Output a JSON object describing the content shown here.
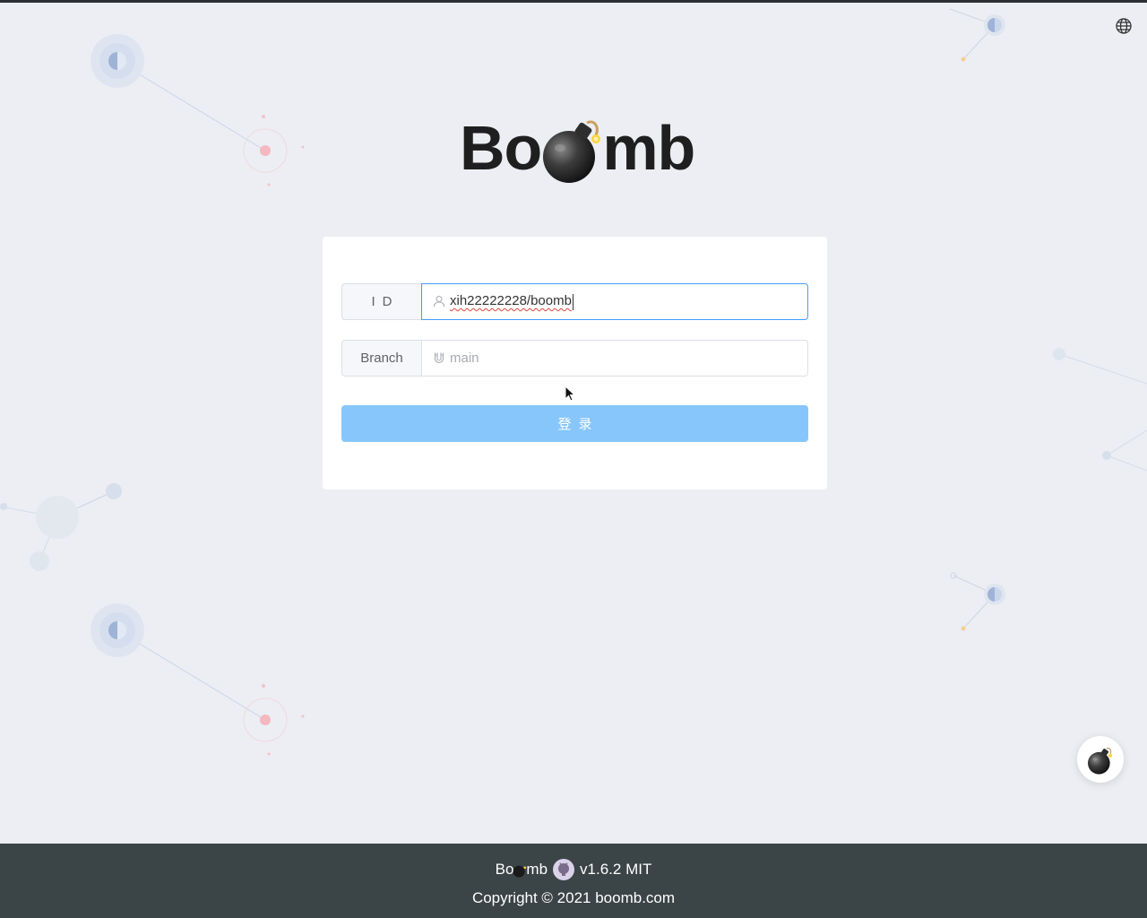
{
  "logo": {
    "left": "Bo",
    "right": "mb"
  },
  "language_icon": "globe-icon",
  "form": {
    "id_label": "ID",
    "id_value": "xih22222228/boomb",
    "id_icon": "user-icon",
    "branch_label": "Branch",
    "branch_placeholder": "main",
    "branch_icon": "magnet-icon",
    "login_label": "登录"
  },
  "floating_button_icon": "bomb-icon",
  "footer": {
    "brand_left": "Bo",
    "brand_right": "mb",
    "github_icon": "github-icon",
    "version": "v1.6.2 MIT",
    "copyright": "Copyright © 2021 boomb.com"
  },
  "colors": {
    "primary_disabled": "#86c6fb",
    "focus_border": "#409eff",
    "footer_bg": "#3b4446",
    "page_bg": "#eceef3"
  }
}
